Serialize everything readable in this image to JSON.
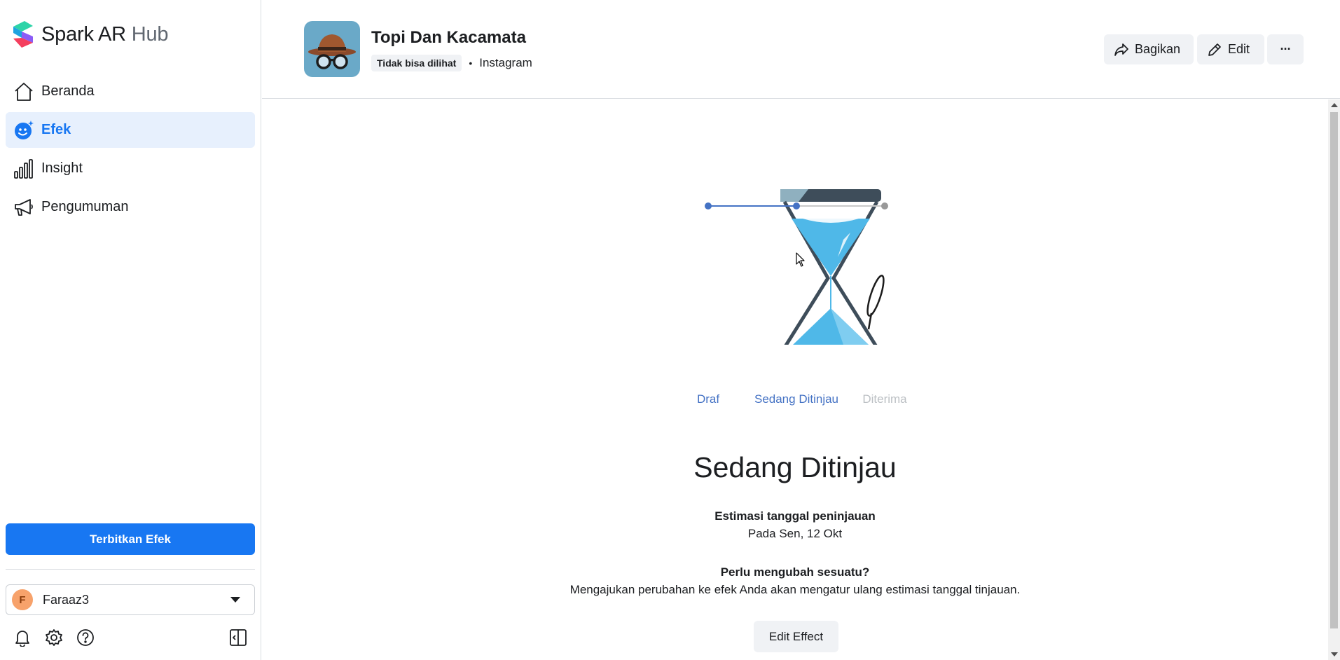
{
  "app": {
    "brand_primary": "Spark AR",
    "brand_secondary": "Hub"
  },
  "sidebar": {
    "items": [
      {
        "label": "Beranda",
        "icon": "home-icon",
        "active": false
      },
      {
        "label": "Efek",
        "icon": "effects-icon",
        "active": true
      },
      {
        "label": "Insight",
        "icon": "bar-chart-icon",
        "active": false
      },
      {
        "label": "Pengumuman",
        "icon": "megaphone-icon",
        "active": false
      }
    ],
    "publish_label": "Terbitkan Efek",
    "account": {
      "initial": "F",
      "name": "Faraaz3"
    },
    "bottom_icons": [
      "bell-icon",
      "gear-icon",
      "help-icon",
      "panel-toggle-icon"
    ]
  },
  "header": {
    "title": "Topi Dan Kacamata",
    "visibility_badge": "Tidak bisa dilihat",
    "separator": "•",
    "platform": "Instagram",
    "share_label": "Bagikan",
    "edit_label": "Edit",
    "more_label": "···"
  },
  "status": {
    "steps": [
      {
        "label": "Draf",
        "state": "done"
      },
      {
        "label": "Sedang Ditinjau",
        "state": "current"
      },
      {
        "label": "Diterima",
        "state": "pending"
      }
    ],
    "title": "Sedang Ditinjau",
    "estimate_label": "Estimasi tanggal peninjauan",
    "estimate_value": "Pada Sen, 12 Okt",
    "change_label": "Perlu mengubah sesuatu?",
    "change_desc": "Mengajukan perubahan ke efek Anda akan mengatur ulang estimasi tanggal tinjauan.",
    "edit_effect_label": "Edit Effect"
  },
  "colors": {
    "accent": "#1877f2",
    "step_active": "#4472c4",
    "step_pending": "#999999",
    "sand": "#4fb8e8",
    "glass_frame": "#3e4d5a"
  }
}
